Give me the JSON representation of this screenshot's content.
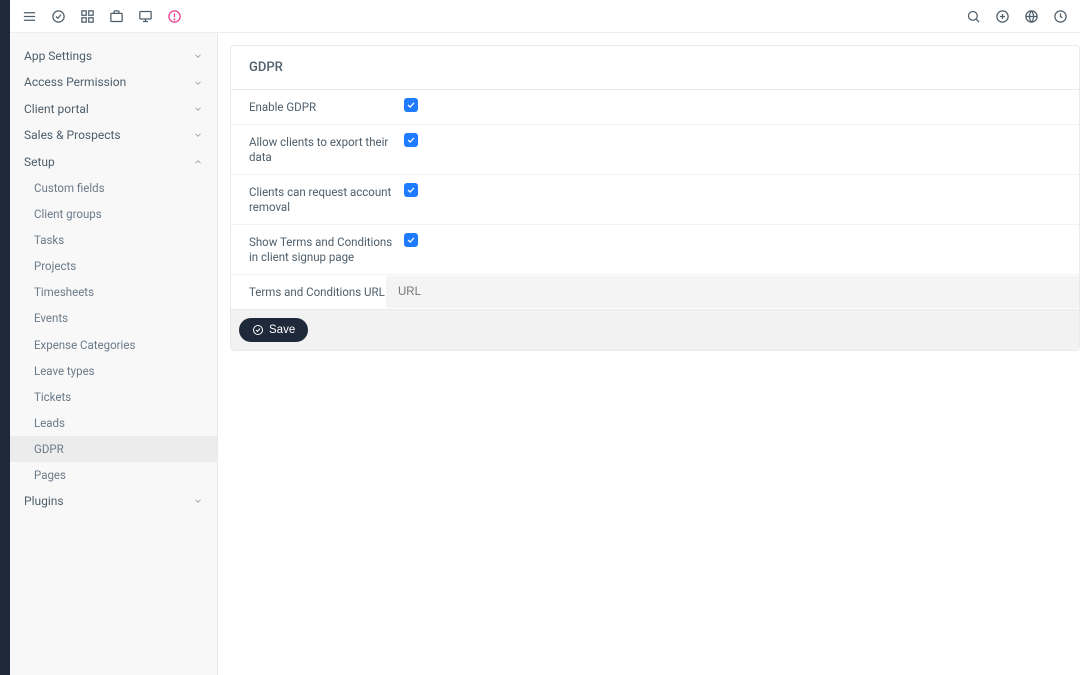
{
  "sidebar": {
    "sections": [
      {
        "label": "App Settings",
        "open": false
      },
      {
        "label": "Access Permission",
        "open": false
      },
      {
        "label": "Client portal",
        "open": false
      },
      {
        "label": "Sales & Prospects",
        "open": false
      },
      {
        "label": "Setup",
        "open": true
      },
      {
        "label": "Plugins",
        "open": false
      }
    ],
    "setup_items": [
      {
        "label": "Custom fields"
      },
      {
        "label": "Client groups"
      },
      {
        "label": "Tasks"
      },
      {
        "label": "Projects"
      },
      {
        "label": "Timesheets"
      },
      {
        "label": "Events"
      },
      {
        "label": "Expense Categories"
      },
      {
        "label": "Leave types"
      },
      {
        "label": "Tickets"
      },
      {
        "label": "Leads"
      },
      {
        "label": "GDPR",
        "active": true
      },
      {
        "label": "Pages"
      }
    ]
  },
  "page": {
    "title": "GDPR",
    "rows": [
      {
        "label": "Enable GDPR",
        "checked": true
      },
      {
        "label": "Allow clients to export their data",
        "checked": true
      },
      {
        "label": "Clients can request account removal",
        "checked": true
      },
      {
        "label": "Show Terms and Conditions in client signup page",
        "checked": true
      }
    ],
    "url_label": "Terms and Conditions URL",
    "url_placeholder": "URL",
    "url_value": "",
    "save_label": "Save"
  }
}
